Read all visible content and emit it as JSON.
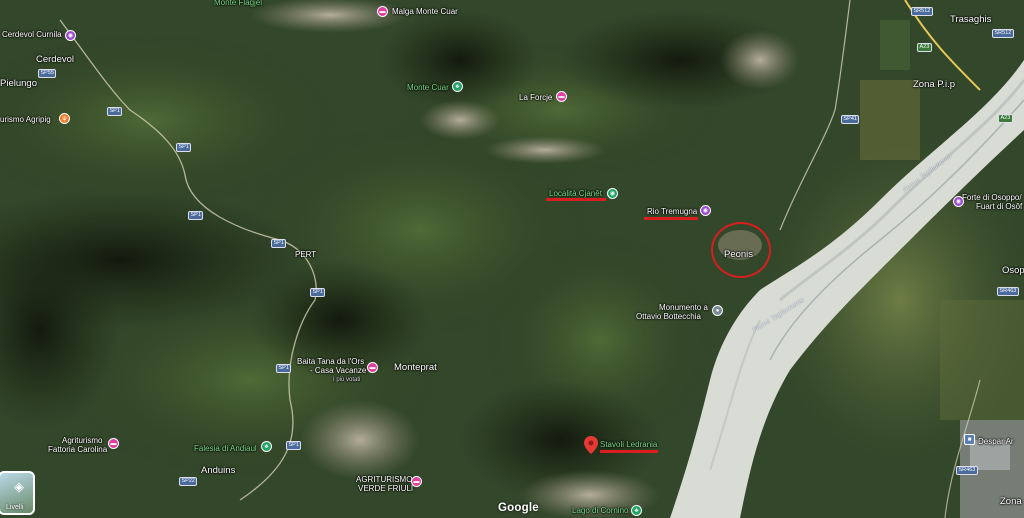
{
  "places": {
    "monte_flagjel": "Monte Flagjel",
    "malga_monte_cuar": "Malga Monte Cuar",
    "cerdevol_curnila": "Cerdevol Curnila",
    "cerdevol": "Cerdevol",
    "pielungo": "Pielungo",
    "agriturismo_agripig": "urismo Agripig",
    "monte_cuar": "Monte Cuar",
    "la_forcje": "La Forcje",
    "localita_cianet": "Località Cjanêt",
    "rio_tremugna": "Rio Tremugna",
    "peonis": "Peonis",
    "pert": "PERT",
    "monumento_line1": "Monumento a",
    "monumento_line2": "Ottavio Bottecchia",
    "baita_line1": "Baita Tana da l'Ors",
    "baita_line2": "- Casa Vacanze",
    "baita_line3": "I più votati",
    "monteprat": "Monteprat",
    "agriturismo_fattoria_line1": "Agriturismo",
    "agriturismo_fattoria_line2": "Fattoria Carolina",
    "falesia_di_andiaul": "Falesia di Andiaul",
    "anduins": "Anduins",
    "agriturismo_verde_line1": "AGRITURISMO",
    "agriturismo_verde_line2": "VERDE FRIULI",
    "stavoli_ledrania": "Stavoli Ledrania",
    "lago_di_cornino": "Lago di Cornino",
    "trasaghis": "Trasaghis",
    "zona_pip": "Zona P.i.p",
    "forte_line1": "Forte di Osoppo/",
    "forte_line2": "Fuart di Osôf",
    "osoppo": "Osopp",
    "despar": "Despar Ar",
    "zona": "Zona",
    "fiume_tagliamento_1": "Fiume Tagliamento",
    "fiume_tagliamento_2": "Fiume Tagliamento"
  },
  "roads": {
    "sp55": "SP55",
    "sp1_a": "SP1",
    "sp1_b": "SP1",
    "sp1_c": "SP1",
    "sp1_d": "SP1",
    "sp1_e": "SP1",
    "sp1_f": "SP1",
    "sp1_g": "SP1",
    "sp22": "SP22",
    "sp41": "SP41",
    "sr512": "SR512",
    "sr512_b": "SR512",
    "a23": "A23",
    "a23_b": "A23",
    "sr463": "SR463",
    "sr463_b": "SR463"
  },
  "map_controls": {
    "google_logo": "Google",
    "layers_label": "Livelli"
  },
  "pin_glyphs": {
    "camera": "◉",
    "hotel": "▬",
    "tree": "♣",
    "food": "🍴"
  },
  "colors": {
    "annotation_red": "#d81e1e",
    "pin_pink": "#e040a0",
    "pin_purple": "#9c4ad1",
    "pin_green": "#1ea565",
    "river_gravel": "#dfe2dc"
  }
}
